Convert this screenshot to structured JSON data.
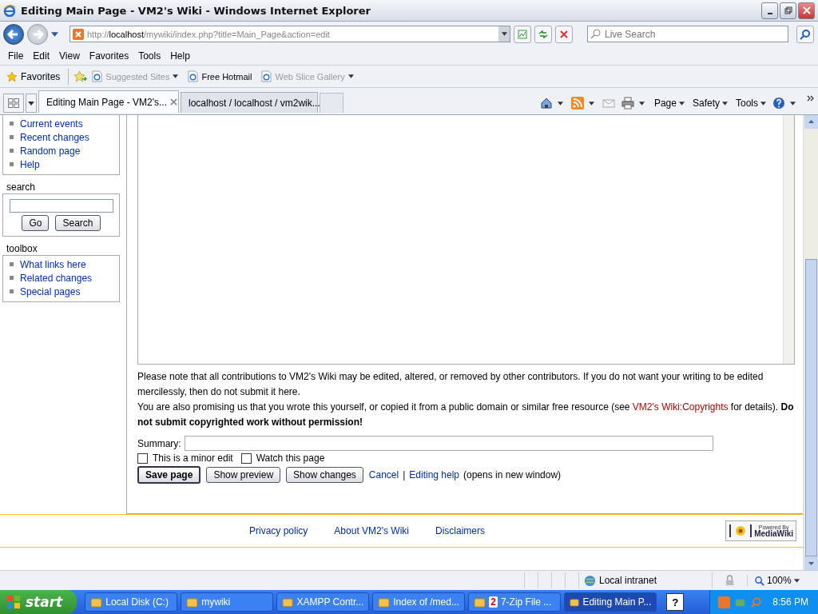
{
  "window": {
    "title": "Editing Main Page - VM2's Wiki - Windows Internet Explorer"
  },
  "address_bar": {
    "url_prefix": "http://",
    "url_host": "localhost",
    "url_rest": "/mywiki/index.php?title=Main_Page&action=edit",
    "search_placeholder": "Live Search"
  },
  "menu": [
    "File",
    "Edit",
    "View",
    "Favorites",
    "Tools",
    "Help"
  ],
  "favorites_bar": {
    "label": "Favorites",
    "items": [
      {
        "label": "Suggested Sites",
        "disabled": true,
        "dropdown": true
      },
      {
        "label": "Free Hotmail",
        "disabled": false,
        "dropdown": false
      },
      {
        "label": "Web Slice Gallery",
        "disabled": true,
        "dropdown": true
      }
    ]
  },
  "tabs": [
    {
      "label": "Editing Main Page - VM2's...",
      "selected": true
    },
    {
      "label": "localhost / localhost / vm2wik...",
      "selected": false
    }
  ],
  "command_bar": [
    "Page",
    "Safety",
    "Tools"
  ],
  "sidebar": {
    "navigation": [
      "Current events",
      "Recent changes",
      "Random page",
      "Help"
    ],
    "search": {
      "title": "search",
      "go": "Go",
      "search": "Search"
    },
    "toolbox": {
      "title": "toolbox",
      "items": [
        "What links here",
        "Related changes",
        "Special pages"
      ]
    }
  },
  "editor": {
    "notice1": "Please note that all contributions to VM2's Wiki may be edited, altered, or removed by other contributors. If you do not want your writing to be edited mercilessly, then do not submit it here.",
    "notice2_before": "You are also promising us that you wrote this yourself, or copied it from a public domain or similar free resource (see ",
    "notice2_link": "VM2's Wiki:Copyrights",
    "notice2_after": " for details). **Do not submit copyrighted work without permission!**",
    "summary_label": "Summary:",
    "checkboxes": [
      {
        "label": "This is a minor edit",
        "checked": false
      },
      {
        "label": "Watch this page",
        "checked": false
      }
    ],
    "buttons": [
      "Save page",
      "Show preview",
      "Show changes"
    ],
    "cancel": "Cancel",
    "separator": "|",
    "help_link": "Editing help",
    "help_note": "(opens in new window)"
  },
  "footer": {
    "links": [
      "Privacy policy",
      "About VM2's Wiki",
      "Disclaimers"
    ],
    "badge_top": "Powered By",
    "badge_bottom": "MediaWiki"
  },
  "status_bar": {
    "zone": "Local intranet",
    "zoom": "100%"
  },
  "taskbar": {
    "start": "start",
    "items": [
      {
        "label": "Local Disk (C:)",
        "selected": false
      },
      {
        "label": "mywiki",
        "selected": false
      },
      {
        "label": "XAMPP Contr...",
        "selected": false
      },
      {
        "label": "Index of /med...",
        "selected": false
      },
      {
        "label": "7-Zip File ...",
        "count": "2",
        "selected": false
      },
      {
        "label": "Editing Main P...",
        "selected": true
      }
    ],
    "help": "?",
    "time": "8:56 PM"
  }
}
